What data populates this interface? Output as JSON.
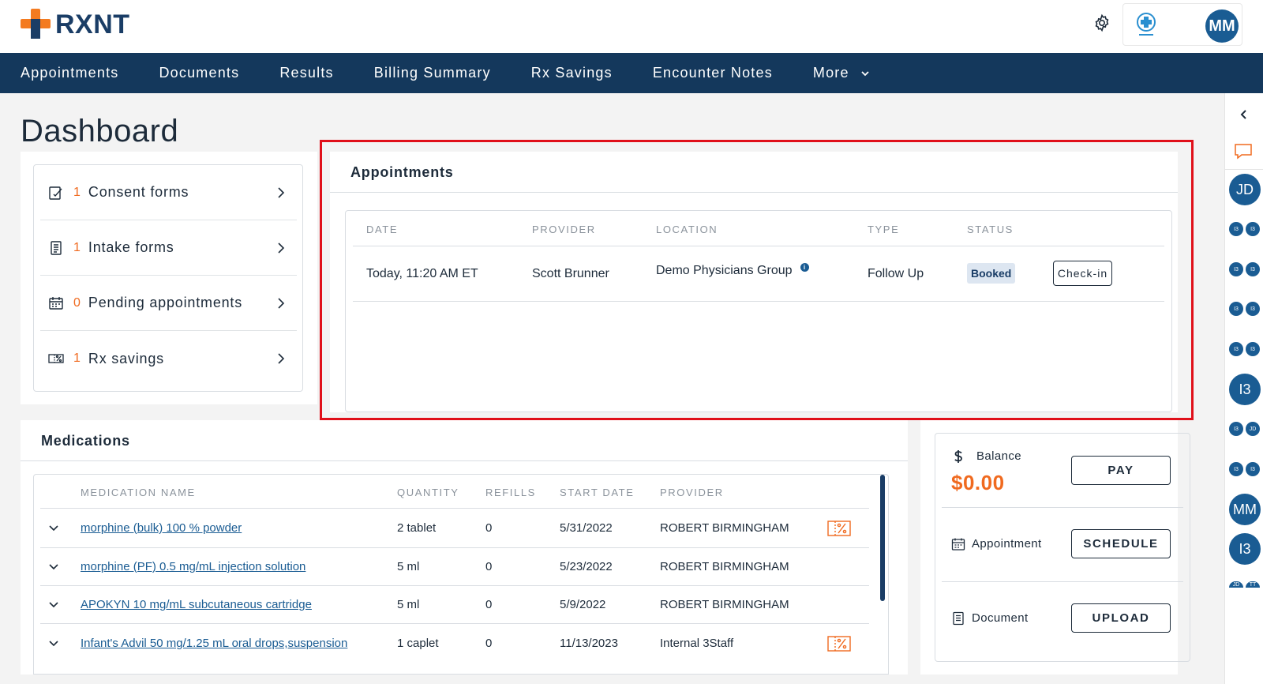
{
  "brand": {
    "name": "RXNT"
  },
  "header": {
    "user_initials": "MM"
  },
  "nav": {
    "items": [
      "Appointments",
      "Documents",
      "Results",
      "Billing Summary",
      "Rx Savings",
      "Encounter Notes"
    ],
    "more_label": "More"
  },
  "page": {
    "title": "Dashboard"
  },
  "quick_links": [
    {
      "count": "1",
      "label": "Consent forms",
      "icon": "consent-form-icon"
    },
    {
      "count": "1",
      "label": "Intake forms",
      "icon": "intake-form-icon"
    },
    {
      "count": "0",
      "label": "Pending appointments",
      "icon": "calendar-icon"
    },
    {
      "count": "1",
      "label": "Rx savings",
      "icon": "coupon-icon"
    }
  ],
  "appointments": {
    "title": "Appointments",
    "columns": [
      "DATE",
      "PROVIDER",
      "LOCATION",
      "TYPE",
      "STATUS"
    ],
    "rows": [
      {
        "date": "Today, 11:20 AM ET",
        "provider": "Scott Brunner",
        "location": "Demo Physicians Group",
        "type": "Follow Up",
        "status": "Booked",
        "action": "Check-in"
      }
    ]
  },
  "medications": {
    "title": "Medications",
    "columns": [
      "MEDICATION NAME",
      "QUANTITY",
      "REFILLS",
      "START DATE",
      "PROVIDER"
    ],
    "rows": [
      {
        "name": "morphine (bulk) 100 % powder",
        "quantity": "2 tablet",
        "refills": "0",
        "start_date": "5/31/2022",
        "provider": "ROBERT BIRMINGHAM",
        "coupon": true
      },
      {
        "name": "morphine (PF) 0.5 mg/mL injection solution",
        "quantity": "5 ml",
        "refills": "0",
        "start_date": "5/23/2022",
        "provider": "ROBERT BIRMINGHAM",
        "coupon": false
      },
      {
        "name": "APOKYN 10 mg/mL subcutaneous cartridge",
        "quantity": "5 ml",
        "refills": "0",
        "start_date": "5/9/2022",
        "provider": "ROBERT BIRMINGHAM",
        "coupon": false
      },
      {
        "name": "Infant's Advil 50 mg/1.25 mL oral drops,suspension",
        "quantity": "1 caplet",
        "refills": "0",
        "start_date": "11/13/2023",
        "provider": "Internal 3Staff",
        "coupon": true
      }
    ]
  },
  "account": {
    "balance_label": "Balance",
    "balance_amount": "$0.00",
    "pay_label": "PAY",
    "appointment_label": "Appointment",
    "schedule_label": "SCHEDULE",
    "document_label": "Document",
    "upload_label": "UPLOAD"
  },
  "rail": {
    "avatars": [
      "JD",
      "I3",
      "MM",
      "I3"
    ],
    "small_avatars": [
      "I3",
      "I3",
      "I3",
      "I3",
      "I3",
      "I3",
      "I3",
      "I3",
      "I3",
      "JD",
      "I3",
      "I3",
      "JD",
      "TT"
    ]
  },
  "colors": {
    "brand_orange": "#f47b20",
    "brand_navy": "#1a3d66",
    "nav_bg": "#14385c",
    "accent_orange": "#f06a1f",
    "link_blue": "#1a5c93",
    "highlight_red": "#e0101a"
  }
}
